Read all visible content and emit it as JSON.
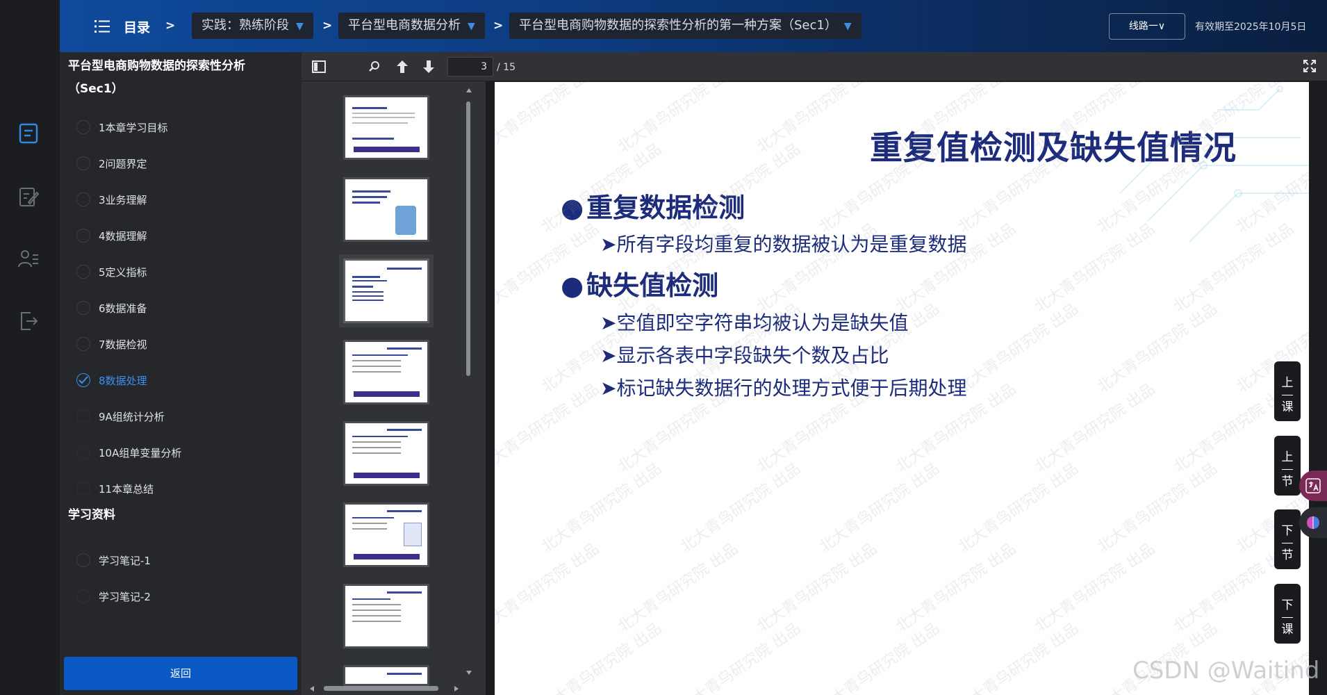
{
  "topbar": {
    "menu_title": "目录",
    "separator": ">",
    "crumbs": [
      "实践：熟练阶段",
      "平台型电商数据分析",
      "平台型电商购物数据的探索性分析的第一种方案（Sec1）"
    ],
    "crumb_arrow": "▼",
    "route_label": "线路一",
    "route_caret": "∨",
    "expire_text": "有效期至2025年10月5日"
  },
  "sidebar": {
    "title": "平台型电商购物数据的探索性分析（Sec1）",
    "lessons": [
      {
        "label": "1本章学习目标",
        "state": "visited"
      },
      {
        "label": "2问题界定",
        "state": "visited"
      },
      {
        "label": "3业务理解",
        "state": "visited"
      },
      {
        "label": "4数据理解",
        "state": "visited"
      },
      {
        "label": "5定义指标",
        "state": "visited"
      },
      {
        "label": "6数据准备",
        "state": "visited"
      },
      {
        "label": "7数据检视",
        "state": "visited"
      },
      {
        "label": "8数据处理",
        "state": "active"
      },
      {
        "label": "9A组统计分析",
        "state": "unvisited"
      },
      {
        "label": "10A组单变量分析",
        "state": "unvisited"
      },
      {
        "label": "11本章总结",
        "state": "unvisited"
      }
    ],
    "materials_title": "学习资料",
    "materials": [
      {
        "label": "学习笔记-1",
        "state": "visited"
      },
      {
        "label": "学习笔记-2",
        "state": "unvisited"
      }
    ],
    "back_label": "返回"
  },
  "viewer": {
    "current_page": "3",
    "total_pages": "/ 15",
    "selected_thumbnail": 3
  },
  "slide": {
    "title": "重复值检测及缺失值情况",
    "bullet_symbol": "●",
    "sub_symbol": "➤",
    "sections": [
      {
        "heading": "重复数据检测",
        "items": [
          "所有字段均重复的数据被认为是重复数据"
        ]
      },
      {
        "heading": "缺失值检测",
        "items": [
          "空值即空字符串均被认为是缺失值",
          "显示各表中字段缺失个数及占比",
          "标记缺失数据行的处理方式便于后期处理"
        ]
      }
    ],
    "watermark": "北大青鸟研究院 出品"
  },
  "float_buttons": [
    {
      "top": "上",
      "bottom": "课"
    },
    {
      "top": "上",
      "bottom": "节"
    },
    {
      "top": "下",
      "bottom": "节"
    },
    {
      "top": "下",
      "bottom": "课"
    }
  ],
  "footer_watermark": "CSDN @Waitind",
  "colors": {
    "accent": "#3b8ff0",
    "button_blue": "#0b59c4",
    "slide_text": "#1c2b7a"
  }
}
